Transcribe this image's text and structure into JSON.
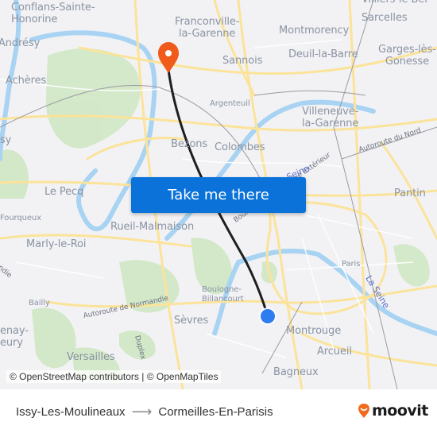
{
  "map": {
    "places": [
      {
        "id": "conflans",
        "label": "Conflans-Sainte-\nHonorine"
      },
      {
        "id": "franconville",
        "label": "Franconville-\nla-Garenne"
      },
      {
        "id": "villiers",
        "label": "Villiers-le-Bel"
      },
      {
        "id": "sarcelles",
        "label": "Sarcelles"
      },
      {
        "id": "montmorency",
        "label": "Montmorency"
      },
      {
        "id": "andresy",
        "label": "Andrésy"
      },
      {
        "id": "sannois",
        "label": "Sannois"
      },
      {
        "id": "deuil",
        "label": "Deuil-la-Barre"
      },
      {
        "id": "garges",
        "label": "Garges-lès-\nGonesse"
      },
      {
        "id": "acheres",
        "label": "Achères"
      },
      {
        "id": "argenteuil",
        "label": "Argenteuil"
      },
      {
        "id": "villeneuve",
        "label": "Villeneuve-\nla-Garenne"
      },
      {
        "id": "poissy",
        "label": "sy"
      },
      {
        "id": "bezons",
        "label": "Bezons"
      },
      {
        "id": "colombes",
        "label": "Colombes"
      },
      {
        "id": "lepecq",
        "label": "Le Pecq"
      },
      {
        "id": "pantin",
        "label": "Pantin"
      },
      {
        "id": "fourqueux",
        "label": "Fourqueux"
      },
      {
        "id": "rueil",
        "label": "Rueil-Malmaison"
      },
      {
        "id": "marly",
        "label": "Marly-le-Roi"
      },
      {
        "id": "paris",
        "label": "Paris"
      },
      {
        "id": "boulogne",
        "label": "Boulogne-\nBillancourt"
      },
      {
        "id": "bailly",
        "label": "Bailly"
      },
      {
        "id": "sevres",
        "label": "Sèvres"
      },
      {
        "id": "montrouge",
        "label": "Montrouge"
      },
      {
        "id": "fontenay",
        "label": "enay-\neury"
      },
      {
        "id": "arcueil",
        "label": "Arcueil"
      },
      {
        "id": "versailles",
        "label": "Versailles"
      },
      {
        "id": "bagneux",
        "label": "Bagneux"
      }
    ],
    "roads": {
      "autoroute_nord": "Autoroute du Nord",
      "autoroute_normandie": "Autoroute de Normandie",
      "boulevard_peripherique": "Boulevard Périphérique Extérieur",
      "duplex": "Duplex",
      "normandie_left": "ndie"
    },
    "water": {
      "seine": "La Seine",
      "seine_north": "Seine"
    },
    "origin_marker": "Issy-Les-Moulineaux",
    "destination_marker": "Cormeilles-En-Parisis",
    "colors": {
      "route": "#1e1e1e",
      "origin": "#2f7bf0",
      "destination": "#f05a1a",
      "button": "#0a72d8"
    }
  },
  "attribution": "© OpenStreetMap contributors | © OpenMapTiles",
  "cta_label": "Take me there",
  "footer": {
    "from": "Issy-Les-Moulineaux",
    "arrow": "⟶",
    "to": "Cormeilles-En-Parisis",
    "brand": "moovit",
    "brand_color": "#f26a1c"
  }
}
